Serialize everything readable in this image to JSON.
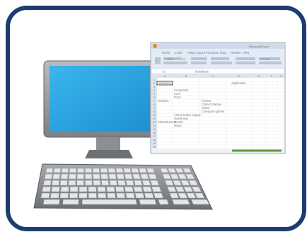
{
  "colors": {
    "frame": "#1c3d6e",
    "screen": "#29a3e0",
    "ribbon": "#e3ebf6",
    "header": "#dde4ee",
    "status_bar": "#5a9c3c"
  },
  "spreadsheet": {
    "title": "Microsoft Excel",
    "tabs": [
      "Home",
      "Insert",
      "Page Layout",
      "Formulas",
      "Data",
      "Review",
      "View"
    ],
    "font_name": "Calibri",
    "font_size": "11",
    "number_format": "General",
    "name_box": "A1",
    "formula_text": "Database",
    "columns": [
      "A",
      "B",
      "C",
      "D",
      "E",
      "F",
      "G"
    ],
    "rows": [
      "1",
      "2",
      "3",
      "4",
      "5",
      "6",
      "7",
      "8",
      "9",
      "10",
      "11",
      "12",
      "13",
      "14",
      "15",
      "16",
      "17",
      "18",
      "19",
      "20"
    ],
    "cells": {
      "a1": "Database",
      "d1": "Application",
      "b3": "Computers",
      "b4": "Cars",
      "b5": "Food",
      "a6": "Hobbies",
      "c6": "Fitness",
      "c7": "Collect Stamps",
      "c8": "Travel",
      "c9": "Computer games",
      "b10": "Arts & Crafts Supply",
      "b11": "Gardening",
      "a12": "Entertainment",
      "b12": "Movies",
      "b13": "Music"
    }
  }
}
